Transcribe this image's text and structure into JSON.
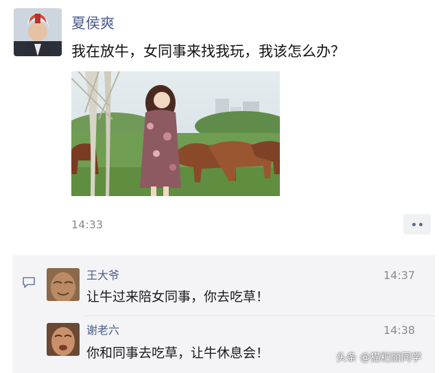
{
  "post": {
    "author": "夏侯爽",
    "text": "我在放牛，女同事来找我玩，我该怎么办？",
    "time": "14:33",
    "more_icon": "more-dots-icon"
  },
  "comments": [
    {
      "author": "王大爷",
      "text": "让牛过来陪女同事，你去吃草！",
      "time": "14:37"
    },
    {
      "author": "谢老六",
      "text": "你和同事去吃草，让牛休息会！",
      "time": "14:38"
    }
  ],
  "watermark": "头条 @猫粑丽同学",
  "colors": {
    "name_link": "#4a5d8a",
    "comment_bg": "#f4f4f6",
    "time_gray": "#8a8a8a"
  }
}
